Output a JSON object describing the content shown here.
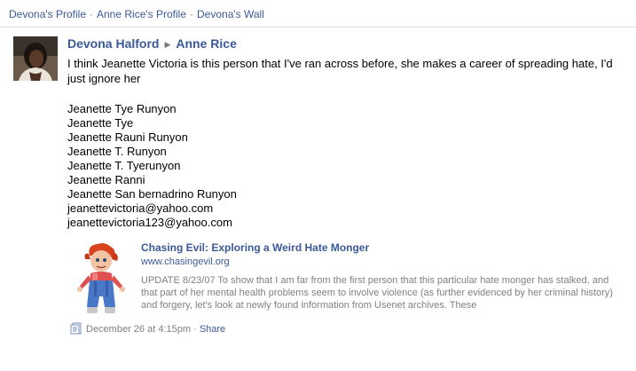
{
  "breadcrumb": {
    "items": [
      "Devona's Profile",
      "Anne Rice's Profile",
      "Devona's Wall"
    ],
    "separator": "·"
  },
  "post": {
    "author": "Devona Halford",
    "arrow": "▶",
    "recipient": "Anne Rice",
    "message": "I think Jeanette Victoria is this person that I've ran across before, she makes a career of spreading hate, I'd just ignore her",
    "names": [
      "Jeanette Tye Runyon",
      "Jeanette Tye",
      "Jeanette Rauni Runyon",
      "Jeanette T. Runyon",
      "Jeanette T. Tyerunyon",
      "Jeanette Ranni",
      "Jeanette San bernadrino Runyon",
      "jeanettevictoria@yahoo.com",
      "jeanettevictoria123@yahoo.com"
    ],
    "attachment": {
      "title": "Chasing Evil: Exploring a Weird Hate Monger",
      "url": "www.chasingevil.org",
      "description": "UPDATE 8/23/07 To show that I am far from the first person that this particular hate monger has stalked, and that part of her mental health problems seem to involve violence (as further evidenced by her criminal history) and forgery, let's look at newly found information from Usenet archives. These"
    },
    "meta": {
      "icon": "note-icon",
      "timestamp": "December 26 at 4:15pm",
      "separator": "·",
      "share_label": "Share"
    }
  },
  "colors": {
    "link": "#3b5998",
    "meta_text": "#808080",
    "divider": "#d8dfea"
  }
}
